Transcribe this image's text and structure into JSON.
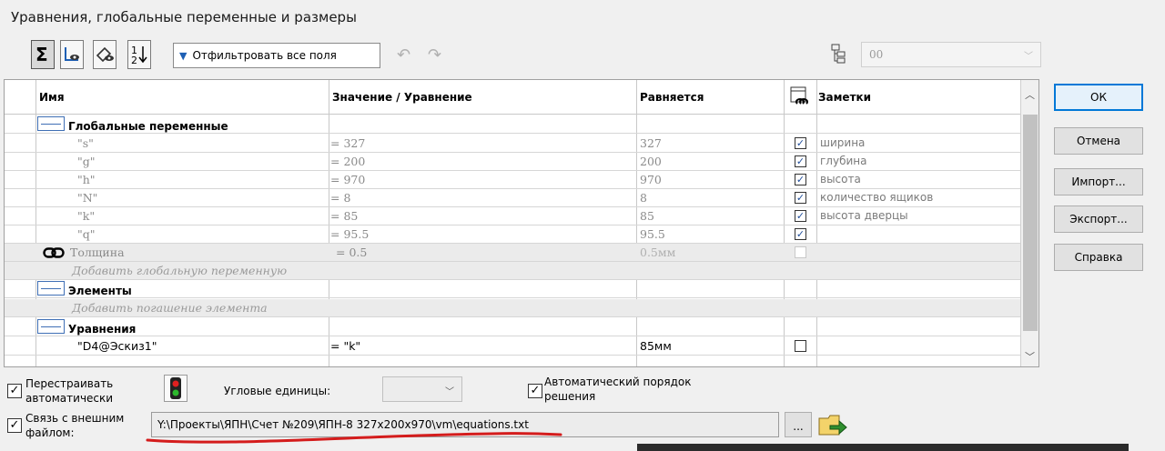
{
  "window": {
    "title": "Уравнения, глобальные переменные и размеры"
  },
  "toolbar": {
    "filter_text": "Отфильтровать все поля",
    "config_value": "00",
    "buttons": [
      "sigma-icon",
      "sketch-view-icon",
      "edit-dims-icon",
      "sort-order-icon"
    ]
  },
  "table": {
    "headers": {
      "name": "Имя",
      "value": "Значение / Уравнение",
      "result": "Равняется",
      "notes": "Заметки"
    },
    "sections": {
      "globals": "Глобальные переменные",
      "features": "Элементы",
      "equations": "Уравнения"
    },
    "rows": [
      {
        "name": "\"s\"",
        "value": "= 327",
        "result": "327",
        "checked": true,
        "note": "ширина"
      },
      {
        "name": "\"g\"",
        "value": "= 200",
        "result": "200",
        "checked": true,
        "note": "глубина"
      },
      {
        "name": "\"h\"",
        "value": "= 970",
        "result": "970",
        "checked": true,
        "note": "высота"
      },
      {
        "name": "\"N\"",
        "value": "= 8",
        "result": "8",
        "checked": true,
        "note": "количество ящиков"
      },
      {
        "name": "\"k\"",
        "value": "= 85",
        "result": "85",
        "checked": true,
        "note": "высота дверцы"
      },
      {
        "name": "\"q\"",
        "value": "= 95.5",
        "result": "95.5",
        "checked": true,
        "note": ""
      }
    ],
    "thickness": {
      "name": "Толщина",
      "value": "= 0.5",
      "result": "0.5мм"
    },
    "add_global": "Добавить глобальную переменную",
    "add_suppression": "Добавить погашение элемента",
    "equation_row": {
      "name": "\"D4@Эскиз1\"",
      "value": "= \"k\"",
      "result": "85мм"
    }
  },
  "side_buttons": {
    "ok": "ОК",
    "cancel": "Отмена",
    "import": "Импорт...",
    "export": "Экспорт...",
    "help": "Справка"
  },
  "bottom": {
    "rebuild_auto_line1": "Перестраивать",
    "rebuild_auto_line2": "автоматически",
    "angle_units_label": "Угловые единицы:",
    "auto_order_line1": "Автоматический порядок",
    "auto_order_line2": "решения",
    "link_file_line1": "Связь с внешним",
    "link_file_line2": "файлом:",
    "file_path": "Y:\\Проекты\\ЯПН\\Счет №209\\ЯПН-8 327x200x970\\vm\\equations.txt",
    "browse_label": "..."
  },
  "colors": {
    "accent": "#0078d7",
    "checkmark": "#1f4d9a",
    "annotation": "#d41c1c"
  }
}
